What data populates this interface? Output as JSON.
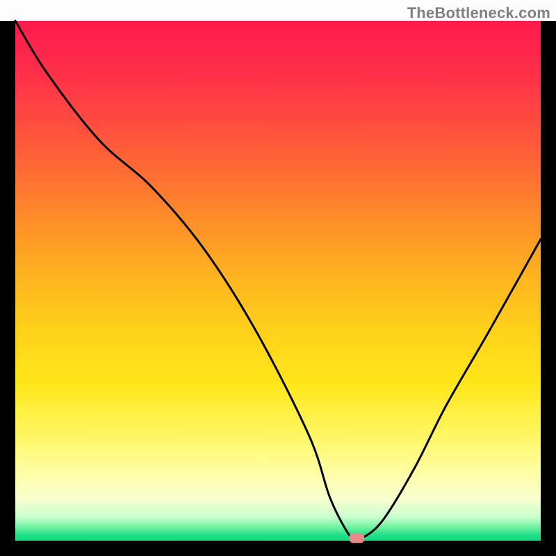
{
  "watermark": "TheBottleneck.com",
  "chart_data": {
    "type": "line",
    "title": "",
    "xlabel": "",
    "ylabel": "",
    "xlim": [
      0,
      100
    ],
    "ylim": [
      0,
      100
    ],
    "x": [
      0,
      6,
      16,
      26,
      36,
      46,
      56,
      60,
      64,
      66,
      70,
      76,
      82,
      90,
      100
    ],
    "values": [
      100,
      90,
      77,
      68,
      56,
      40,
      20,
      8,
      0.5,
      0.5,
      4,
      14,
      26,
      40,
      58
    ],
    "curve_color": "#000000",
    "marker": {
      "x": 65,
      "y": 0.5,
      "color": "#e98a8a"
    },
    "background_gradient_stops": [
      {
        "offset": 0.0,
        "color": "#ff1a4d"
      },
      {
        "offset": 0.1,
        "color": "#ff2f49"
      },
      {
        "offset": 0.2,
        "color": "#ff4d3f"
      },
      {
        "offset": 0.3,
        "color": "#ff6f33"
      },
      {
        "offset": 0.4,
        "color": "#ff9428"
      },
      {
        "offset": 0.5,
        "color": "#ffb61f"
      },
      {
        "offset": 0.6,
        "color": "#ffd21a"
      },
      {
        "offset": 0.7,
        "color": "#ffe71a"
      },
      {
        "offset": 0.8,
        "color": "#fff766"
      },
      {
        "offset": 0.87,
        "color": "#ffffa6"
      },
      {
        "offset": 0.92,
        "color": "#f8ffd0"
      },
      {
        "offset": 0.955,
        "color": "#c7ffcc"
      },
      {
        "offset": 0.975,
        "color": "#6cf2a0"
      },
      {
        "offset": 0.99,
        "color": "#1ce085"
      },
      {
        "offset": 1.0,
        "color": "#13d87c"
      }
    ]
  }
}
